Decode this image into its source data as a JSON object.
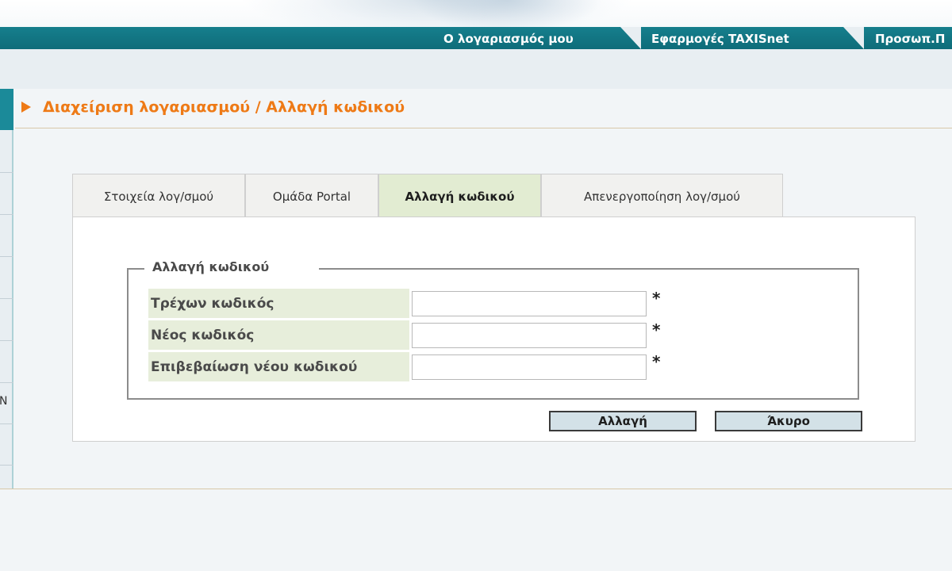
{
  "topnav": {
    "items": [
      {
        "label": "Ο λογαριασμός μου"
      },
      {
        "label": "Εφαρμογές TAXISnet"
      },
      {
        "label": "Προσωπ.Π"
      }
    ]
  },
  "left_strip": {
    "visible_letter": "Ν"
  },
  "page": {
    "title": "Διαχείριση λογαριασμού / Αλλαγή κωδικού"
  },
  "tabs": [
    {
      "label": "Στοιχεία λογ/σμού",
      "active": false
    },
    {
      "label": "Ομάδα Portal",
      "active": false
    },
    {
      "label": "Αλλαγή κωδικού",
      "active": true
    },
    {
      "label": "Απενεργοποίηση λογ/σμού",
      "active": false
    }
  ],
  "form": {
    "legend": "Αλλαγή κωδικού",
    "fields": [
      {
        "label": "Τρέχων κωδικός",
        "value": "",
        "required_mark": "*"
      },
      {
        "label": "Νέος κωδικός",
        "value": "",
        "required_mark": "*"
      },
      {
        "label": "Επιβεβαίωση νέου κωδικού",
        "value": "",
        "required_mark": "*"
      }
    ],
    "submit_label": "Αλλαγή",
    "cancel_label": "Άκυρο"
  },
  "colors": {
    "nav_teal": "#0e6c79",
    "title_orange": "#ee7a16",
    "active_tab_green": "#e2ecd2",
    "label_bg": "#e7eedb",
    "button_bg": "#d3e1e7"
  }
}
